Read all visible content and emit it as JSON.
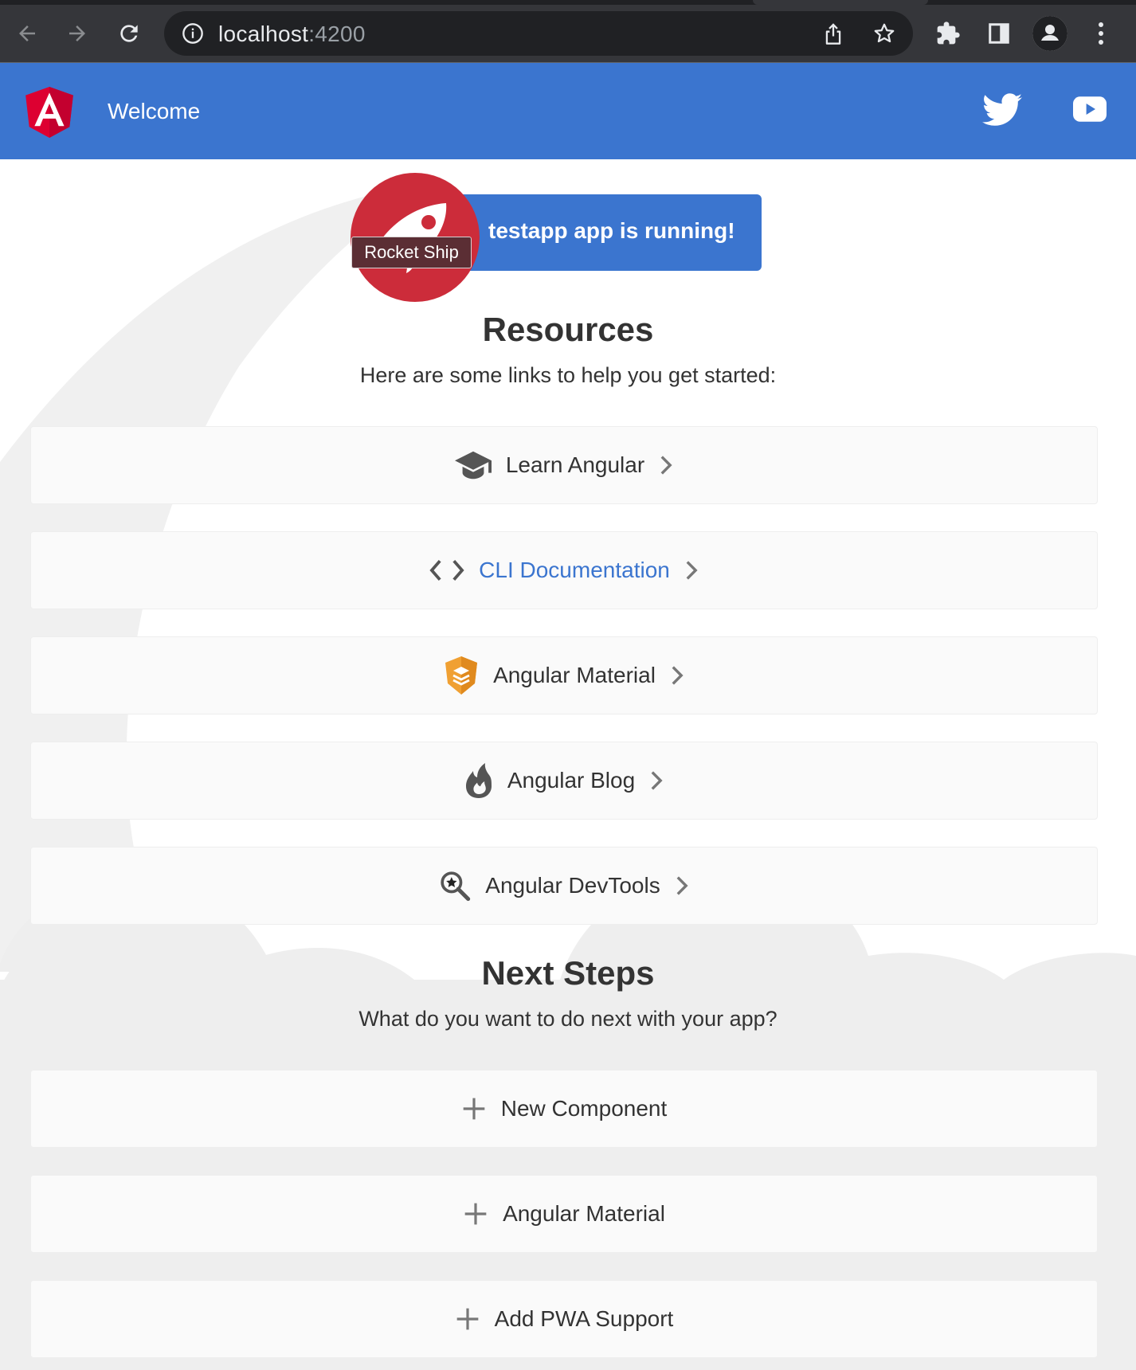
{
  "browser": {
    "url_host": "localhost",
    "url_port": ":4200"
  },
  "app": {
    "title": "Welcome"
  },
  "banner": {
    "text": "testapp app is running!",
    "tooltip": "Rocket Ship"
  },
  "resources": {
    "title": "Resources",
    "subtitle": "Here are some links to help you get started:",
    "items": [
      {
        "label": "Learn Angular",
        "icon": "graduation-cap-icon"
      },
      {
        "label": "CLI Documentation",
        "icon": "code-brackets-icon"
      },
      {
        "label": "Angular Material",
        "icon": "material-shield-icon"
      },
      {
        "label": "Angular Blog",
        "icon": "flame-icon"
      },
      {
        "label": "Angular DevTools",
        "icon": "magnifier-star-icon"
      }
    ]
  },
  "next_steps": {
    "title": "Next Steps",
    "subtitle": "What do you want to do next with your app?",
    "items": [
      {
        "label": "New Component",
        "icon": "plus-icon"
      },
      {
        "label": "Angular Material",
        "icon": "plus-icon"
      },
      {
        "label": "Add PWA Support",
        "icon": "plus-icon"
      }
    ]
  },
  "colors": {
    "toolbar": "#3b75cf",
    "angular_red": "#dd0031",
    "rocket_red": "#cc2c3a",
    "link_blue": "#3b75cf"
  }
}
